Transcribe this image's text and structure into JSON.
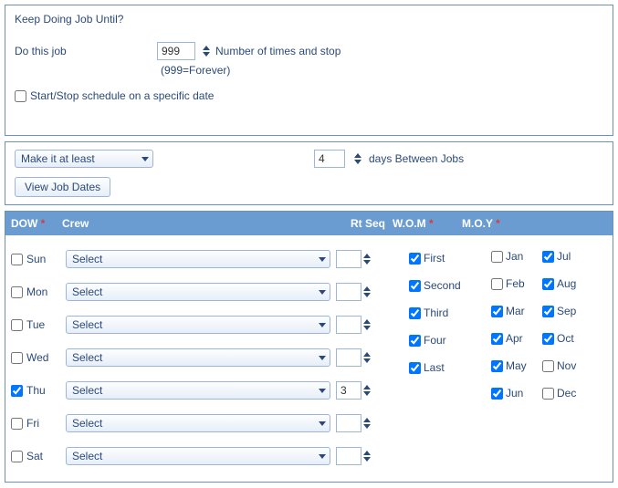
{
  "keep": {
    "title": "Keep Doing Job Until?",
    "do_label": "Do this job",
    "times_value": "999",
    "times_note": "Number of times and stop",
    "forever_note": "(999=Forever)",
    "startstop_label": "Start/Stop schedule on a specific date"
  },
  "between": {
    "combo_label": "Make it at least",
    "days_value": "4",
    "days_label": "days Between Jobs",
    "view_btn": "View Job Dates"
  },
  "headers": {
    "dow": "DOW",
    "crew": "Crew",
    "rt": "Rt Seq",
    "wom": "W.O.M",
    "moy": "M.O.Y"
  },
  "crew_placeholder": "Select",
  "days": [
    {
      "label": "Sun",
      "checked": false,
      "rt": ""
    },
    {
      "label": "Mon",
      "checked": false,
      "rt": ""
    },
    {
      "label": "Tue",
      "checked": false,
      "rt": ""
    },
    {
      "label": "Wed",
      "checked": false,
      "rt": ""
    },
    {
      "label": "Thu",
      "checked": true,
      "rt": "3"
    },
    {
      "label": "Fri",
      "checked": false,
      "rt": ""
    },
    {
      "label": "Sat",
      "checked": false,
      "rt": ""
    }
  ],
  "wom": [
    {
      "label": "First",
      "checked": true
    },
    {
      "label": "Second",
      "checked": true
    },
    {
      "label": "Third",
      "checked": true
    },
    {
      "label": "Four",
      "checked": true
    },
    {
      "label": "Last",
      "checked": true
    }
  ],
  "moy": {
    "left": [
      {
        "label": "Jan",
        "checked": false
      },
      {
        "label": "Feb",
        "checked": false
      },
      {
        "label": "Mar",
        "checked": true
      },
      {
        "label": "Apr",
        "checked": true
      },
      {
        "label": "May",
        "checked": true
      },
      {
        "label": "Jun",
        "checked": true
      }
    ],
    "right": [
      {
        "label": "Jul",
        "checked": true
      },
      {
        "label": "Aug",
        "checked": true
      },
      {
        "label": "Sep",
        "checked": true
      },
      {
        "label": "Oct",
        "checked": true
      },
      {
        "label": "Nov",
        "checked": false
      },
      {
        "label": "Dec",
        "checked": false
      }
    ]
  }
}
